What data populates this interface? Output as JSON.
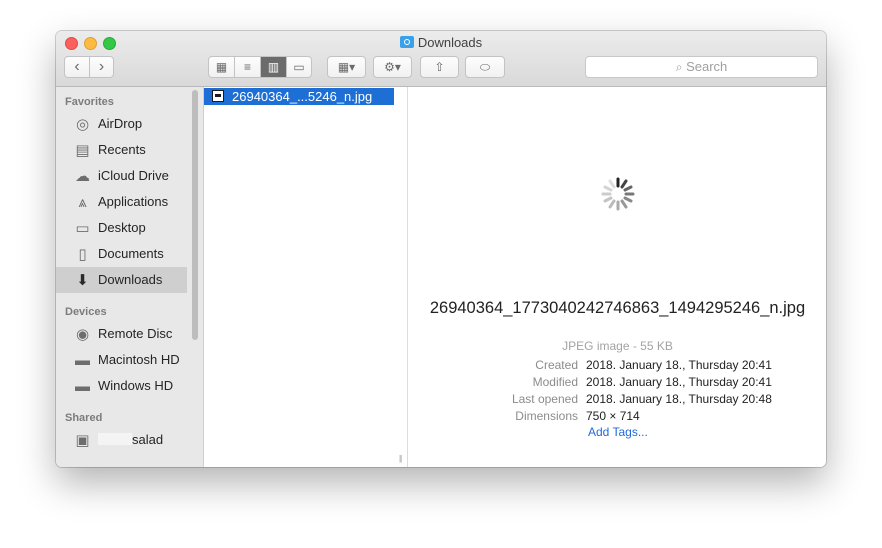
{
  "window": {
    "title": "Downloads"
  },
  "toolbar": {
    "search_placeholder": "Search",
    "nav_back": "‹",
    "nav_forward": "›",
    "view_icons": "▦",
    "view_list": "≡",
    "view_columns": "▥",
    "view_gallery": "▭",
    "group": "▦▾",
    "action": "⚙▾",
    "share": "⇧",
    "tag": "⬭"
  },
  "sidebar": {
    "favorites_header": "Favorites",
    "devices_header": "Devices",
    "shared_header": "Shared",
    "favorites": [
      {
        "label": "AirDrop",
        "icon": "airdrop-icon"
      },
      {
        "label": "Recents",
        "icon": "recents-icon"
      },
      {
        "label": "iCloud Drive",
        "icon": "cloud-icon"
      },
      {
        "label": "Applications",
        "icon": "applications-icon"
      },
      {
        "label": "Desktop",
        "icon": "desktop-icon"
      },
      {
        "label": "Documents",
        "icon": "documents-icon"
      },
      {
        "label": "Downloads",
        "icon": "downloads-icon"
      }
    ],
    "devices": [
      {
        "label": "Remote Disc",
        "icon": "disc-icon"
      },
      {
        "label": "Macintosh HD",
        "icon": "drive-icon"
      },
      {
        "label": "Windows HD",
        "icon": "drive-icon"
      }
    ],
    "shared": [
      {
        "label": "salad",
        "icon": "computer-icon"
      }
    ],
    "selected": "Downloads"
  },
  "column": {
    "files": [
      {
        "name": "26940364_...5246_n.jpg",
        "selected": true
      }
    ]
  },
  "preview": {
    "filename": "26940364_1773040242746863_1494295246_n.jpg",
    "kind": "JPEG image - 55 KB",
    "meta": [
      {
        "label": "Created",
        "value": "2018. January 18., Thursday 20:41"
      },
      {
        "label": "Modified",
        "value": "2018. January 18., Thursday 20:41"
      },
      {
        "label": "Last opened",
        "value": "2018. January 18., Thursday 20:48"
      },
      {
        "label": "Dimensions",
        "value": "750 × 714"
      }
    ],
    "add_tags": "Add Tags..."
  },
  "colors": {
    "selection": "#1d6fd6",
    "link": "#1f6ad9",
    "sidebar_bg": "#e8e8e8",
    "close": "#fc605c",
    "minimize": "#fdbc40",
    "maximize": "#34c84a"
  }
}
